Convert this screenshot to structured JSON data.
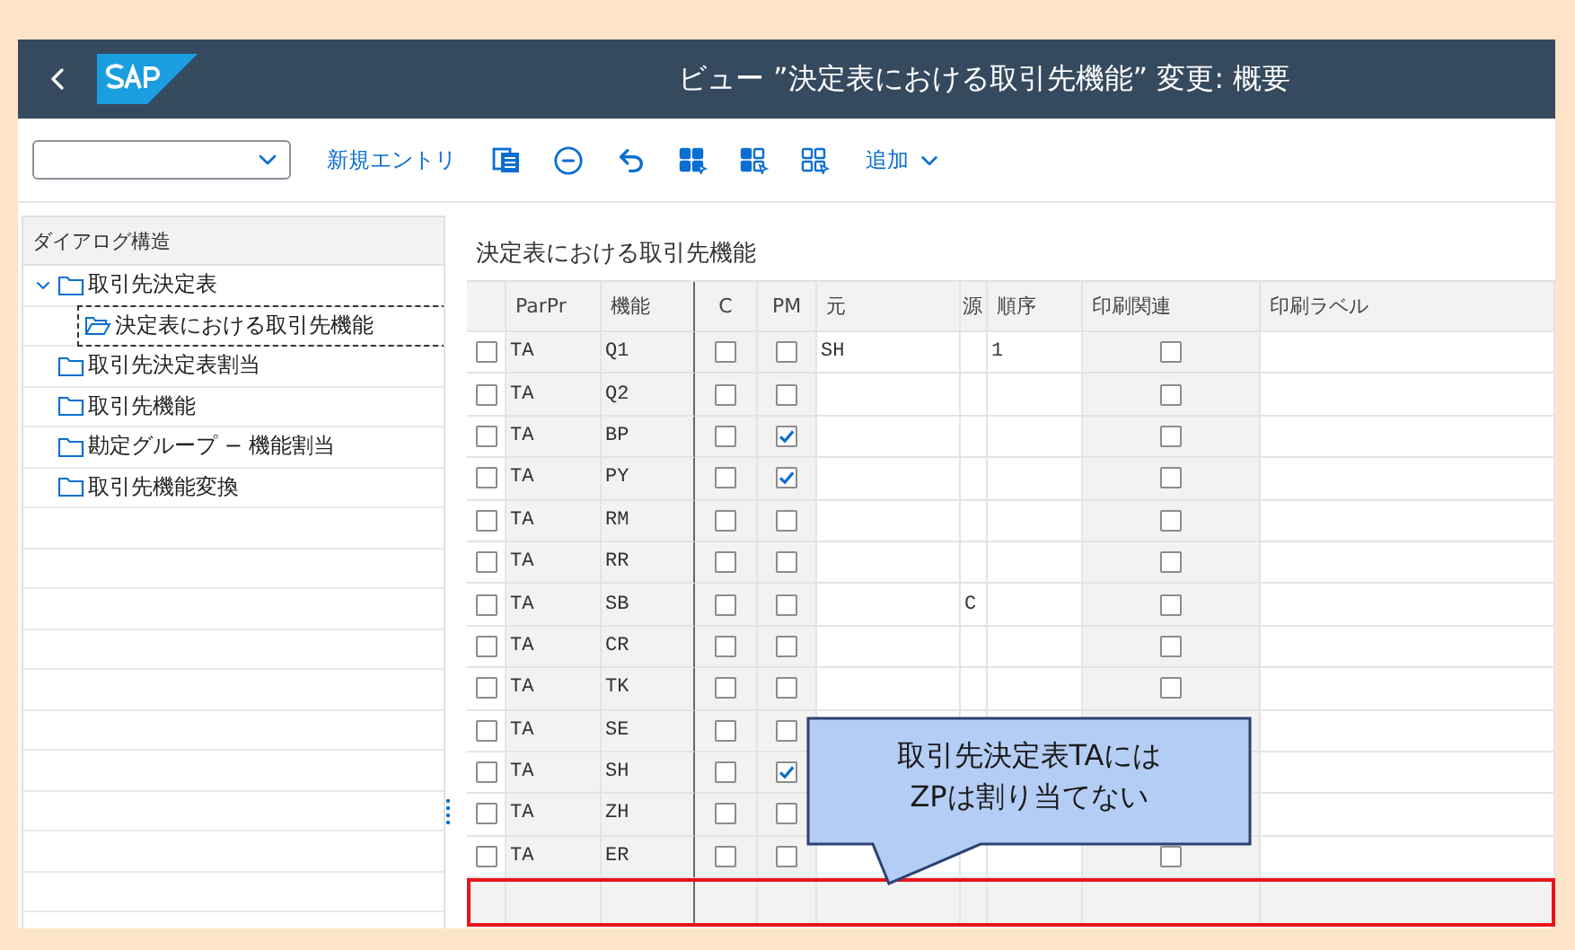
{
  "header": {
    "title": "ビュー ”決定表における取引先機能” 変更: 概要"
  },
  "toolbar": {
    "new_entry": "新規エントリ",
    "add": "追加"
  },
  "tree": {
    "title": "ダイアログ構造",
    "items": [
      {
        "label": "取引先決定表",
        "expanded": true,
        "selected": false,
        "children": [
          {
            "label": "決定表における取引先機能",
            "selected": true
          }
        ]
      },
      {
        "label": "取引先決定表割当",
        "expanded": false,
        "selected": false
      },
      {
        "label": "取引先機能",
        "expanded": false,
        "selected": false
      },
      {
        "label": "勘定グループ − 機能割当",
        "expanded": false,
        "selected": false
      },
      {
        "label": "取引先機能変換",
        "expanded": false,
        "selected": false
      }
    ]
  },
  "table": {
    "title": "決定表における取引先機能",
    "columns": [
      "ParPr",
      "機能",
      "C",
      "PM",
      "元",
      "源",
      "順序",
      "印刷関連",
      "印刷ラベル"
    ],
    "rows": [
      {
        "selected": false,
        "parpr": "TA",
        "function": "Q1",
        "c": false,
        "pm": false,
        "origin": "SH",
        "order": "1",
        "print_related": false
      },
      {
        "selected": false,
        "parpr": "TA",
        "function": "Q2",
        "c": false,
        "pm": false,
        "print_related": false
      },
      {
        "selected": false,
        "parpr": "TA",
        "function": "BP",
        "c": false,
        "pm": true,
        "print_related": false
      },
      {
        "selected": false,
        "parpr": "TA",
        "function": "PY",
        "c": false,
        "pm": true,
        "print_related": false
      },
      {
        "selected": false,
        "parpr": "TA",
        "function": "RM",
        "c": false,
        "pm": false,
        "print_related": false
      },
      {
        "selected": false,
        "parpr": "TA",
        "function": "RR",
        "c": false,
        "pm": false,
        "print_related": false
      },
      {
        "selected": false,
        "parpr": "TA",
        "function": "SB",
        "c": false,
        "pm": false,
        "src": "C",
        "print_related": false
      },
      {
        "selected": false,
        "parpr": "TA",
        "function": "CR",
        "c": false,
        "pm": false,
        "print_related": false
      },
      {
        "selected": false,
        "parpr": "TA",
        "function": "TK",
        "c": false,
        "pm": false,
        "print_related": false
      },
      {
        "selected": false,
        "parpr": "TA",
        "function": "SE",
        "c": false,
        "pm": false
      },
      {
        "selected": false,
        "parpr": "TA",
        "function": "SH",
        "c": false,
        "pm": true
      },
      {
        "selected": false,
        "parpr": "TA",
        "function": "ZH",
        "c": false,
        "pm": false
      },
      {
        "selected": false,
        "parpr": "TA",
        "function": "ER",
        "c": false,
        "pm": false,
        "print_related": false
      }
    ],
    "empty_row_highlighted": true
  },
  "callout": {
    "lines": [
      "取引先決定表TAには",
      "ZPは割り当てない"
    ]
  }
}
